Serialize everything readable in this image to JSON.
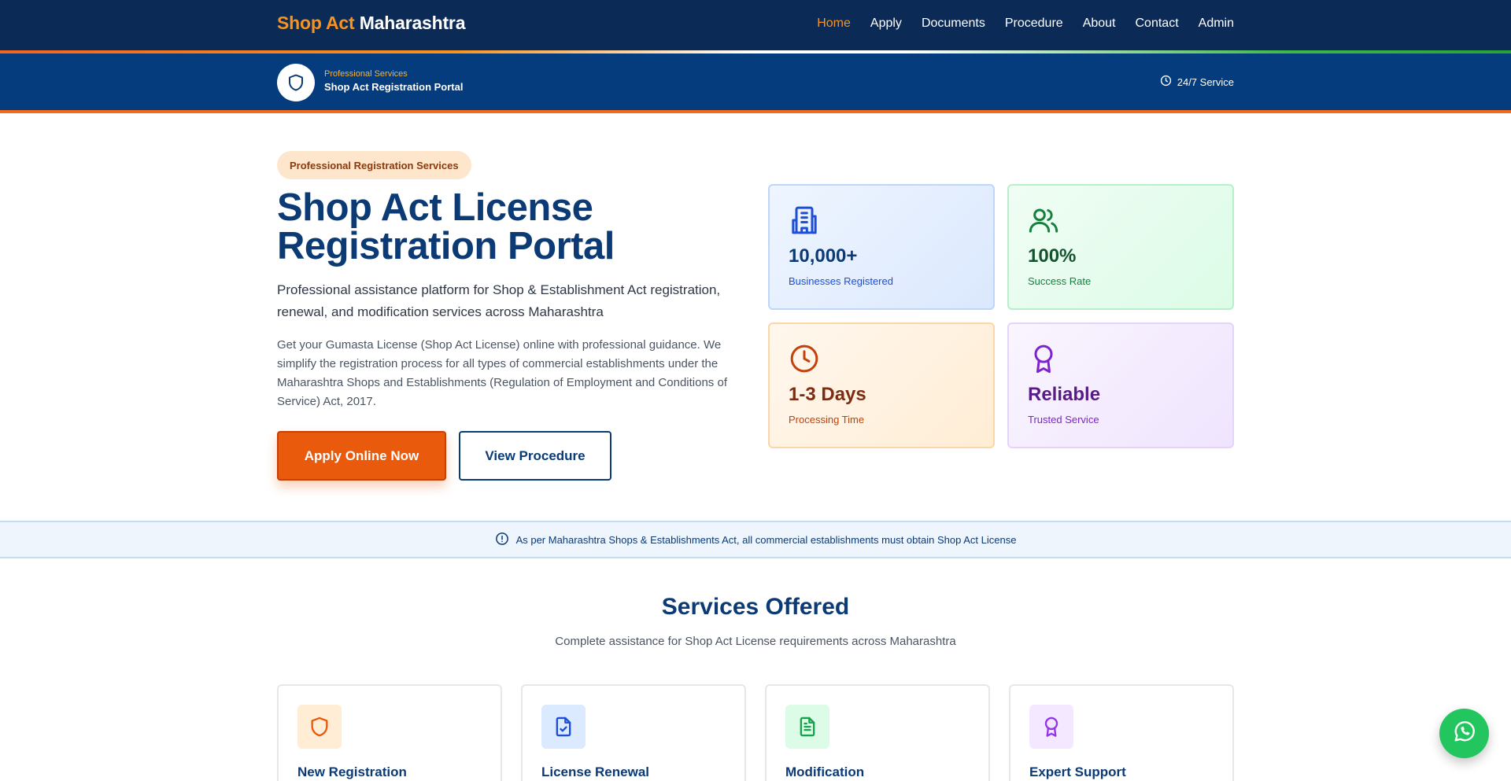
{
  "nav": {
    "brand_part1": "Shop Act",
    "brand_part2": "Maharashtra",
    "links": [
      "Home",
      "Apply",
      "Documents",
      "Procedure",
      "About",
      "Contact",
      "Admin"
    ],
    "active": "Home"
  },
  "subheader": {
    "kicker": "Professional Services",
    "title": "Shop Act Registration Portal",
    "service": "24/7 Service",
    "icons": [
      "shield-icon",
      "clock-icon"
    ]
  },
  "hero": {
    "pill": "Professional Registration Services",
    "title": "Shop Act License Registration Portal",
    "lead": "Professional assistance platform for Shop & Establishment Act registration, renewal, and modification services across Maharashtra",
    "description": "Get your Gumasta License (Shop Act License) online with professional guidance. We simplify the registration process for all types of commercial establishments under the Maharashtra Shops and Establishments (Regulation of Employment and Conditions of Service) Act, 2017.",
    "primary_button": "Apply Online Now",
    "secondary_button": "View Procedure"
  },
  "stats": [
    {
      "value": "10,000+",
      "label": "Businesses Registered",
      "icon": "building-icon",
      "color": "#1d4ed8"
    },
    {
      "value": "100%",
      "label": "Success Rate",
      "icon": "users-icon",
      "color": "#15803d"
    },
    {
      "value": "1-3 Days",
      "label": "Processing Time",
      "icon": "clock-icon",
      "color": "#c2410c"
    },
    {
      "value": "Reliable",
      "label": "Trusted Service",
      "icon": "award-icon",
      "color": "#7e22ce"
    }
  ],
  "notice": {
    "text": "As per Maharashtra Shops & Establishments Act, all commercial establishments must obtain Shop Act License",
    "icon": "alert-circle-icon"
  },
  "services": {
    "title": "Services Offered",
    "subtitle": "Complete assistance for Shop Act License requirements across Maharashtra",
    "items": [
      {
        "name": "New Registration",
        "icon": "shield-icon",
        "color": "#ea580c"
      },
      {
        "name": "License Renewal",
        "icon": "file-check-icon",
        "color": "#1d4ed8"
      },
      {
        "name": "Modification",
        "icon": "file-text-icon",
        "color": "#16a34a"
      },
      {
        "name": "Expert Support",
        "icon": "award-icon",
        "color": "#9333ea"
      }
    ]
  },
  "colors": {
    "navy": "#0b2a55",
    "primary_blue": "#043c7e",
    "accent_orange": "#ea5a0c",
    "whatsapp_green": "#22c55e"
  },
  "floating": {
    "icon": "whatsapp-icon"
  }
}
